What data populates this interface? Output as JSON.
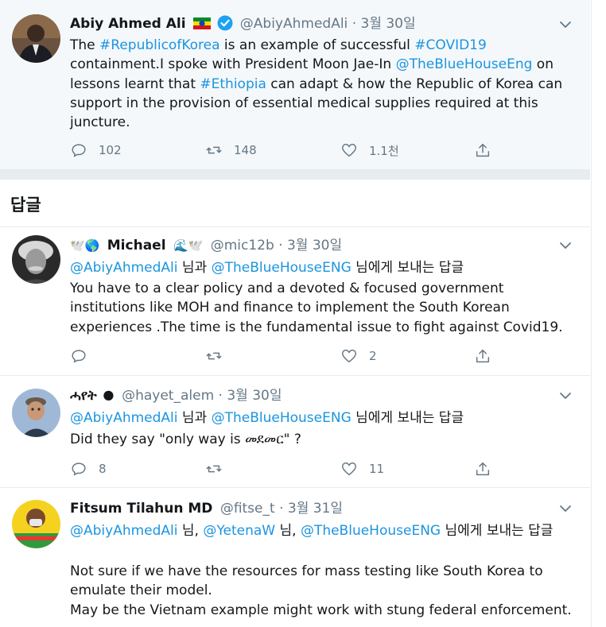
{
  "main_tweet": {
    "name": "Abiy Ahmed Ali",
    "handle": "@AbiyAhmedAli",
    "date": "3월 30일",
    "text_parts": [
      {
        "t": "The ",
        "hl": false
      },
      {
        "t": "#RepublicofKorea",
        "hl": true
      },
      {
        "t": " is an example of successful ",
        "hl": false
      },
      {
        "t": "#COVID19",
        "hl": true
      },
      {
        "t": "\n containment.I spoke with President Moon Jae-In ",
        "hl": false
      },
      {
        "t": "@TheBlueHouseEng",
        "hl": true
      },
      {
        "t": " on lessons learnt that ",
        "hl": false
      },
      {
        "t": "#Ethiopia",
        "hl": true
      },
      {
        "t": " can adapt & how the Republic of Korea can support in the provision of essential medical supplies required at this juncture.",
        "hl": false
      }
    ],
    "replies": "102",
    "retweets": "148",
    "likes": "1.1천"
  },
  "replies_heading": "답글",
  "replies": [
    {
      "name": "Michael",
      "name_prefix": "🕊️🌎",
      "name_suffix": "🌊🕊️",
      "handle": "@mic12b",
      "date": "3월 30일",
      "replying_parts": [
        {
          "t": "@AbiyAhmedAli",
          "hl": true
        },
        {
          "t": " 님과 ",
          "hl": false
        },
        {
          "t": "@TheBlueHouseENG",
          "hl": true
        },
        {
          "t": " 님에게 보내는 답글",
          "hl": false
        }
      ],
      "text": "You have to a clear policy and a devoted & focused government institutions like MOH and finance to implement the South Korean experiences .The time is the fundamental issue to fight against Covid19.",
      "replies": "",
      "retweets": "",
      "likes": "2"
    },
    {
      "name": "ሓየት",
      "name_suffix": "🌑",
      "handle": "@hayet_alem",
      "date": "3월 30일",
      "replying_parts": [
        {
          "t": "@AbiyAhmedAli",
          "hl": true
        },
        {
          "t": " 님과 ",
          "hl": false
        },
        {
          "t": "@TheBlueHouseENG",
          "hl": true
        },
        {
          "t": " 님에게 보내는 답글",
          "hl": false
        }
      ],
      "text": "Did they say \"only way is መደመር\" ?",
      "replies": "8",
      "retweets": "",
      "likes": "11"
    },
    {
      "name": "Fitsum Tilahun MD",
      "handle": "@fitse_t",
      "date": "3월 31일",
      "replying_parts": [
        {
          "t": "@AbiyAhmedAli",
          "hl": true
        },
        {
          "t": " 님, ",
          "hl": false
        },
        {
          "t": "@YetenaW",
          "hl": true
        },
        {
          "t": " 님, ",
          "hl": false
        },
        {
          "t": "@TheBlueHouseENG",
          "hl": true
        },
        {
          "t": " 님에게 보내는 답글",
          "hl": false
        }
      ],
      "text": "Not sure if we have the resources for  mass testing like South Korea to emulate their model.\nMay be the Vietnam example might work with stung federal enforcement."
    }
  ],
  "colors": {
    "link": "#1b95e0",
    "muted": "#657786",
    "verified": "#1da1f2",
    "divider": "#e6ecf0"
  },
  "icons": [
    "reply-icon",
    "retweet-icon",
    "like-icon",
    "share-icon",
    "chevron-down-icon",
    "verified-badge-icon",
    "ethiopia-flag-icon"
  ]
}
